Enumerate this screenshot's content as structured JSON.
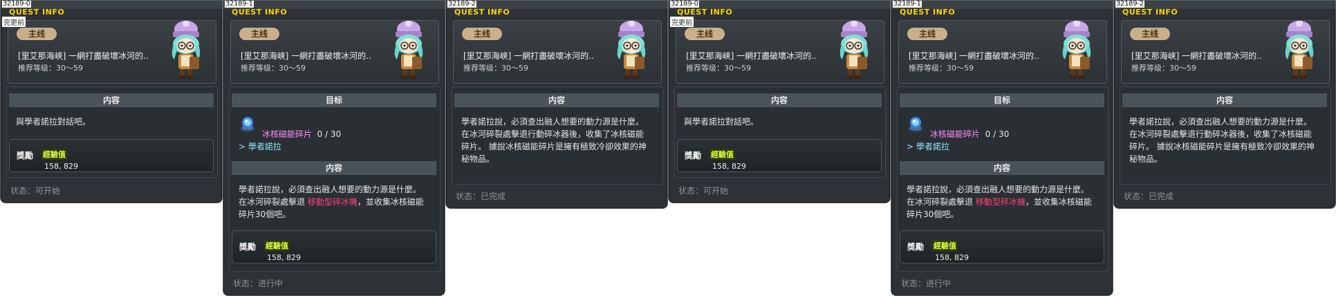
{
  "common": {
    "quest_info": "QUEST INFO",
    "category": "主线",
    "title": "[里艾那海峡] 一網打盡破壞冰河的..",
    "level_label": "推荐等级：",
    "level_range": "30〜59",
    "content_header": "内容",
    "goal_header": "目标",
    "reward_label": "獎勵",
    "exp_label": "經驗值",
    "exp_value": "158, 829",
    "status_label": "状态："
  },
  "panels": [
    {
      "id": "32189-0",
      "sub": "完更前",
      "content": [
        "與學者諾拉對話吧。"
      ],
      "status": "可开始"
    },
    {
      "id": "32189-1",
      "goal_item": "冰核磁能碎片",
      "goal_count": "0 / 30",
      "goal_npc_arrow": ">",
      "goal_npc": "學者諾拉",
      "content_a": "學者諾拉說，必須查出融人想要的動力源是什麼。",
      "content_b_pre": "在冰河碎裂處擊退 ",
      "content_b_red": "移動型碎冰機",
      "content_b_post": "，並收集冰核磁能",
      "content_c": "碎片30個吧。",
      "status": "进行中"
    },
    {
      "id": "32189-2",
      "content": [
        "學者諾拉說，必須查出融人想要的動力源是什麼。",
        "在冰河碎裂處擊退行動碎冰器後，收集了冰核磁能",
        "碎片。 據說冰核磁能碎片是擁有極致冷卻效果的神",
        "秘物品。"
      ],
      "status": "已完成"
    },
    {
      "id": "32189-0",
      "sub": "完更前",
      "content": [
        "與學者諾拉對話吧。"
      ],
      "status": "可开始"
    },
    {
      "id": "32189-1",
      "goal_item": "冰核磁能碎片",
      "goal_count": "0 / 30",
      "goal_npc_arrow": ">",
      "goal_npc": "學者諾拉",
      "content_a": "學者諾拉說，必須查出融人想要的動力源是什麼。",
      "content_b_pre": "在冰河碎裂處擊退 ",
      "content_b_red": "移動型碎冰機",
      "content_b_post": "，並收集冰核磁能",
      "content_c": "碎片30個吧。",
      "status": "进行中"
    },
    {
      "id": "32189-2",
      "content": [
        "學者諾拉說，必須查出融人想要的動力源是什麼。",
        "在冰河碎裂處擊退行動碎冰器後，收集了冰核磁能",
        "碎片。 據說冰核磁能碎片是擁有極致冷卻效果的神",
        "秘物品。"
      ],
      "status": "已完成"
    }
  ]
}
